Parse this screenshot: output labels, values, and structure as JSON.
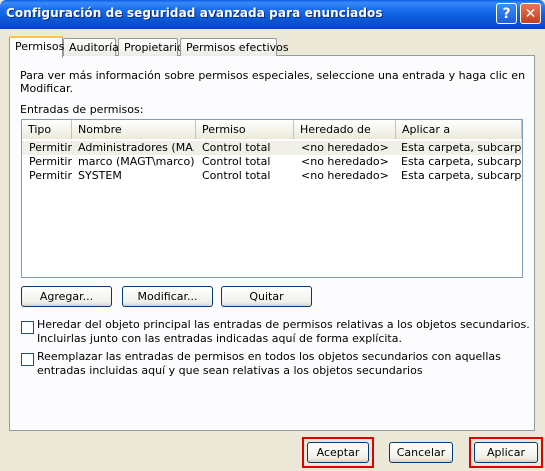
{
  "window": {
    "title": "Configuración de seguridad avanzada para enunciados"
  },
  "titlebar_buttons": {
    "help": "?",
    "close": "✕"
  },
  "tabs": [
    {
      "label": "Permisos"
    },
    {
      "label": "Auditoría"
    },
    {
      "label": "Propietario"
    },
    {
      "label": "Permisos efectivos"
    }
  ],
  "info_text": "Para ver más información sobre permisos especiales, seleccione una entrada y haga clic en Modificar.",
  "entries_label": "Entradas de permisos:",
  "table": {
    "columns": [
      "Tipo",
      "Nombre",
      "Permiso",
      "Heredado de",
      "Aplicar a"
    ],
    "rows": [
      [
        "Permitir",
        "Administradores (MA...",
        "Control total",
        "<no heredado>",
        "Esta carpeta, subcarp..."
      ],
      [
        "Permitir",
        "marco (MAGT\\marco)",
        "Control total",
        "<no heredado>",
        "Esta carpeta, subcarp..."
      ],
      [
        "Permitir",
        "SYSTEM",
        "Control total",
        "<no heredado>",
        "Esta carpeta, subcarp..."
      ]
    ]
  },
  "buttons": {
    "add": "Agregar...",
    "edit": "Modificar...",
    "remove": "Quitar",
    "ok": "Aceptar",
    "cancel": "Cancelar",
    "apply": "Aplicar"
  },
  "checkboxes": {
    "inherit": {
      "label": "Heredar del objeto principal las entradas de permisos relativas a los objetos secundarios. Incluirlas junto con las entradas indicadas aquí de forma explícita.",
      "checked": false
    },
    "replace": {
      "label": "Reemplazar las entradas de permisos en todos los objetos secundarios con aquellas entradas incluidas aquí y que sean relativas a los objetos secundarios",
      "checked": false
    }
  },
  "colors": {
    "titlebar": "#0a5fe6",
    "dialog_bg": "#ece9d8",
    "highlight": "#e00000",
    "active_tab_accent": "#ffc83c"
  }
}
